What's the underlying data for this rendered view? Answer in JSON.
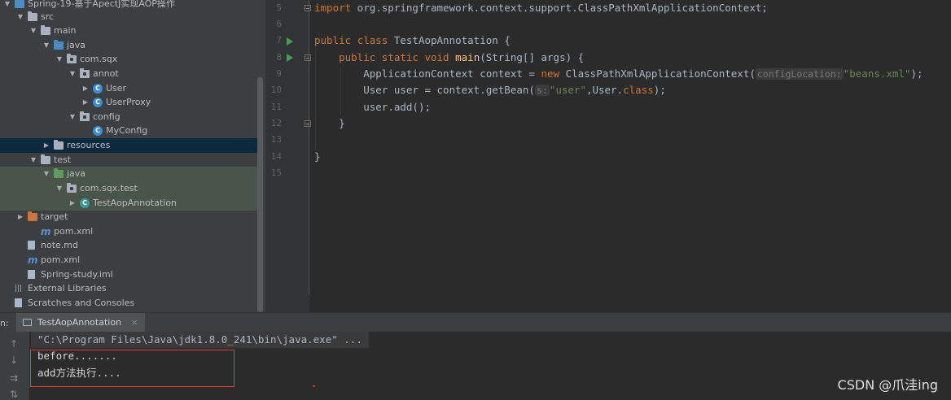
{
  "project_tree": [
    {
      "label": "Spring-19-基于ApectJ实现AOP操作",
      "icon": "module-folder-icon",
      "expanded": true
    },
    {
      "label": "src",
      "icon": "folder-icon",
      "expanded": true
    },
    {
      "label": "main",
      "icon": "folder-icon",
      "expanded": true
    },
    {
      "label": "java",
      "icon": "source-folder-icon",
      "expanded": true
    },
    {
      "label": "com.sqx",
      "icon": "package-icon",
      "expanded": true
    },
    {
      "label": "annot",
      "icon": "package-icon",
      "expanded": true
    },
    {
      "label": "User",
      "icon": "class-icon",
      "expanded": false
    },
    {
      "label": "UserProxy",
      "icon": "class-icon",
      "expanded": false
    },
    {
      "label": "config",
      "icon": "package-icon",
      "expanded": true
    },
    {
      "label": "MyConfig",
      "icon": "class-icon"
    },
    {
      "label": "resources",
      "icon": "resources-folder-icon",
      "expanded": false
    },
    {
      "label": "test",
      "icon": "folder-icon",
      "expanded": true
    },
    {
      "label": "java",
      "icon": "test-folder-icon",
      "expanded": true
    },
    {
      "label": "com.sqx.test",
      "icon": "package-icon",
      "expanded": true
    },
    {
      "label": "TestAopAnnotation",
      "icon": "test-class-icon",
      "expanded": false
    },
    {
      "label": "target",
      "icon": "excluded-folder-icon",
      "expanded": false
    },
    {
      "label": "pom.xml",
      "icon": "maven-icon"
    },
    {
      "label": "note.md",
      "icon": "markdown-file-icon"
    },
    {
      "label": "pom.xml",
      "icon": "maven-icon"
    },
    {
      "label": "Spring-study.iml",
      "icon": "iml-file-icon"
    },
    {
      "label": "External Libraries",
      "icon": "libraries-icon"
    },
    {
      "label": "Scratches and Consoles",
      "icon": "scratches-icon"
    }
  ],
  "editor": {
    "line_numbers": [
      "5",
      "6",
      "7",
      "8",
      "9",
      "10",
      "11",
      "12",
      "13",
      "14",
      "15"
    ],
    "l5": {
      "kw": "import",
      "rest": " org.springframework.context.support.ClassPathXmlApplicationContext;"
    },
    "l7": {
      "kw1": "public",
      "kw2": "class",
      "rest": " TestAopAnnotation {"
    },
    "l8": {
      "kw1": "public",
      "kw2": "static",
      "kw3": "void",
      "fn": "main",
      "rest": "(String[] args) {"
    },
    "l9": {
      "a": "ApplicationContext context = ",
      "kw": "new",
      "b": " ClassPathXmlApplicationContext(",
      "hint": "configLocation:",
      "str": "\"beans.xml\"",
      "c": ");"
    },
    "l10": {
      "a": "User user = context.getBean(",
      "hint": "s:",
      "str": "\"user\"",
      "b": ",User.",
      "kw": "class",
      "c": ");"
    },
    "l11": {
      "a": "user.add();"
    },
    "l12": {
      "a": "}"
    },
    "l14": {
      "a": "}"
    }
  },
  "run_panel": {
    "label": "n:",
    "tab": "TestAopAnnotation",
    "tab_close": "×",
    "command": "\"C:\\Program Files\\Java\\jdk1.8.0_241\\bin\\java.exe\" ...",
    "output": [
      "before.......",
      "add方法执行...."
    ],
    "toolbar": {
      "up": "↑",
      "down": "↓",
      "wrap": "⇉",
      "sort": "⇅"
    }
  },
  "watermark": "CSDN @爪洼ing",
  "colors": {
    "keyword": "#cc7832",
    "string": "#6a8759",
    "method": "#ffc66d",
    "highlight_box": "#e8403a"
  }
}
